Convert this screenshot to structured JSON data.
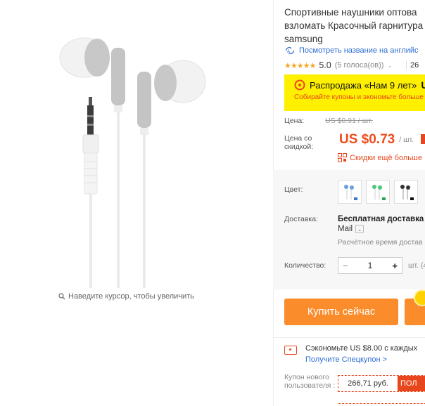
{
  "gallery": {
    "zoom_hint": "Наведите курсор, чтобы увеличить"
  },
  "product": {
    "title_lines": [
      "Спортивные наушники оптова",
      "взломать Красочный гарнитура",
      "samsung"
    ],
    "translate_link": "Посмотреть название на английс",
    "rating": {
      "stars": "★★★★★",
      "score": "5.0",
      "votes": "(5 голоса(ов))",
      "orders": "26"
    }
  },
  "sale": {
    "title": "Распродажа «Нам 9 лет»",
    "title_tail": "U",
    "subtitle": "Собирайте купоны и экономьте больше"
  },
  "price": {
    "old_label": "Цена:",
    "old_value": "US $0.91 / шт.",
    "new_label": "Цена со скидкой:",
    "new_value": "US $0.73",
    "per_unit": "/ шт.",
    "discount_link": "Скидки ещё больше"
  },
  "options": {
    "color_label": "Цвет:",
    "shipping_label": "Доставка:",
    "shipping_main": "Бесплатная доставка в",
    "shipping_method": "Mail",
    "shipping_est": "Расчётное время достав",
    "qty_label": "Количество:",
    "qty_value": "1",
    "qty_minus": "−",
    "qty_plus": "+",
    "qty_unit": "шт. (4"
  },
  "actions": {
    "buy_now": "Купить сейчас"
  },
  "coupons": {
    "save_text": "Сэкономьте US $8.00 с каждых",
    "save_link": "Получите Спецкупон >",
    "newuser_label": "Купон нового пользователя :",
    "coupon_value": "266,71 руб.",
    "coupon_get": "ПОЛ"
  },
  "colors": {
    "accent": "#ef4d1c",
    "buy_button": "#fb8c2b",
    "sale_banner": "#fff000",
    "link": "#2e6dd3"
  }
}
